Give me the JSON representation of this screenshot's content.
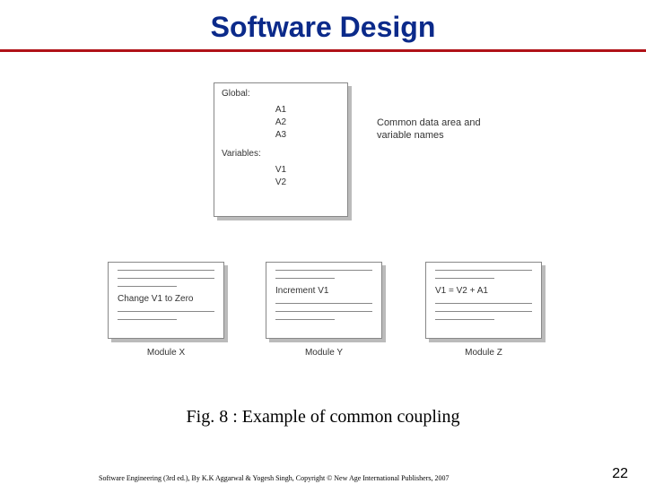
{
  "title": "Software Design",
  "globalBox": {
    "label1": "Global:",
    "a1": "A1",
    "a2": "A2",
    "a3": "A3",
    "label2": "Variables:",
    "v1": "V1",
    "v2": "V2"
  },
  "annotation": "Common data area and variable names",
  "modules": {
    "x": {
      "text": "Change V1 to Zero",
      "label": "Module X"
    },
    "y": {
      "text": "Increment V1",
      "label": "Module Y"
    },
    "z": {
      "text": "V1 = V2 + A1",
      "label": "Module Z"
    }
  },
  "caption": "Fig. 8 : Example of common coupling",
  "footer": "Software Engineering (3rd ed.), By K.K Aggarwal & Yogesh Singh, Copyright © New Age International Publishers, 2007",
  "slideNumber": "22"
}
